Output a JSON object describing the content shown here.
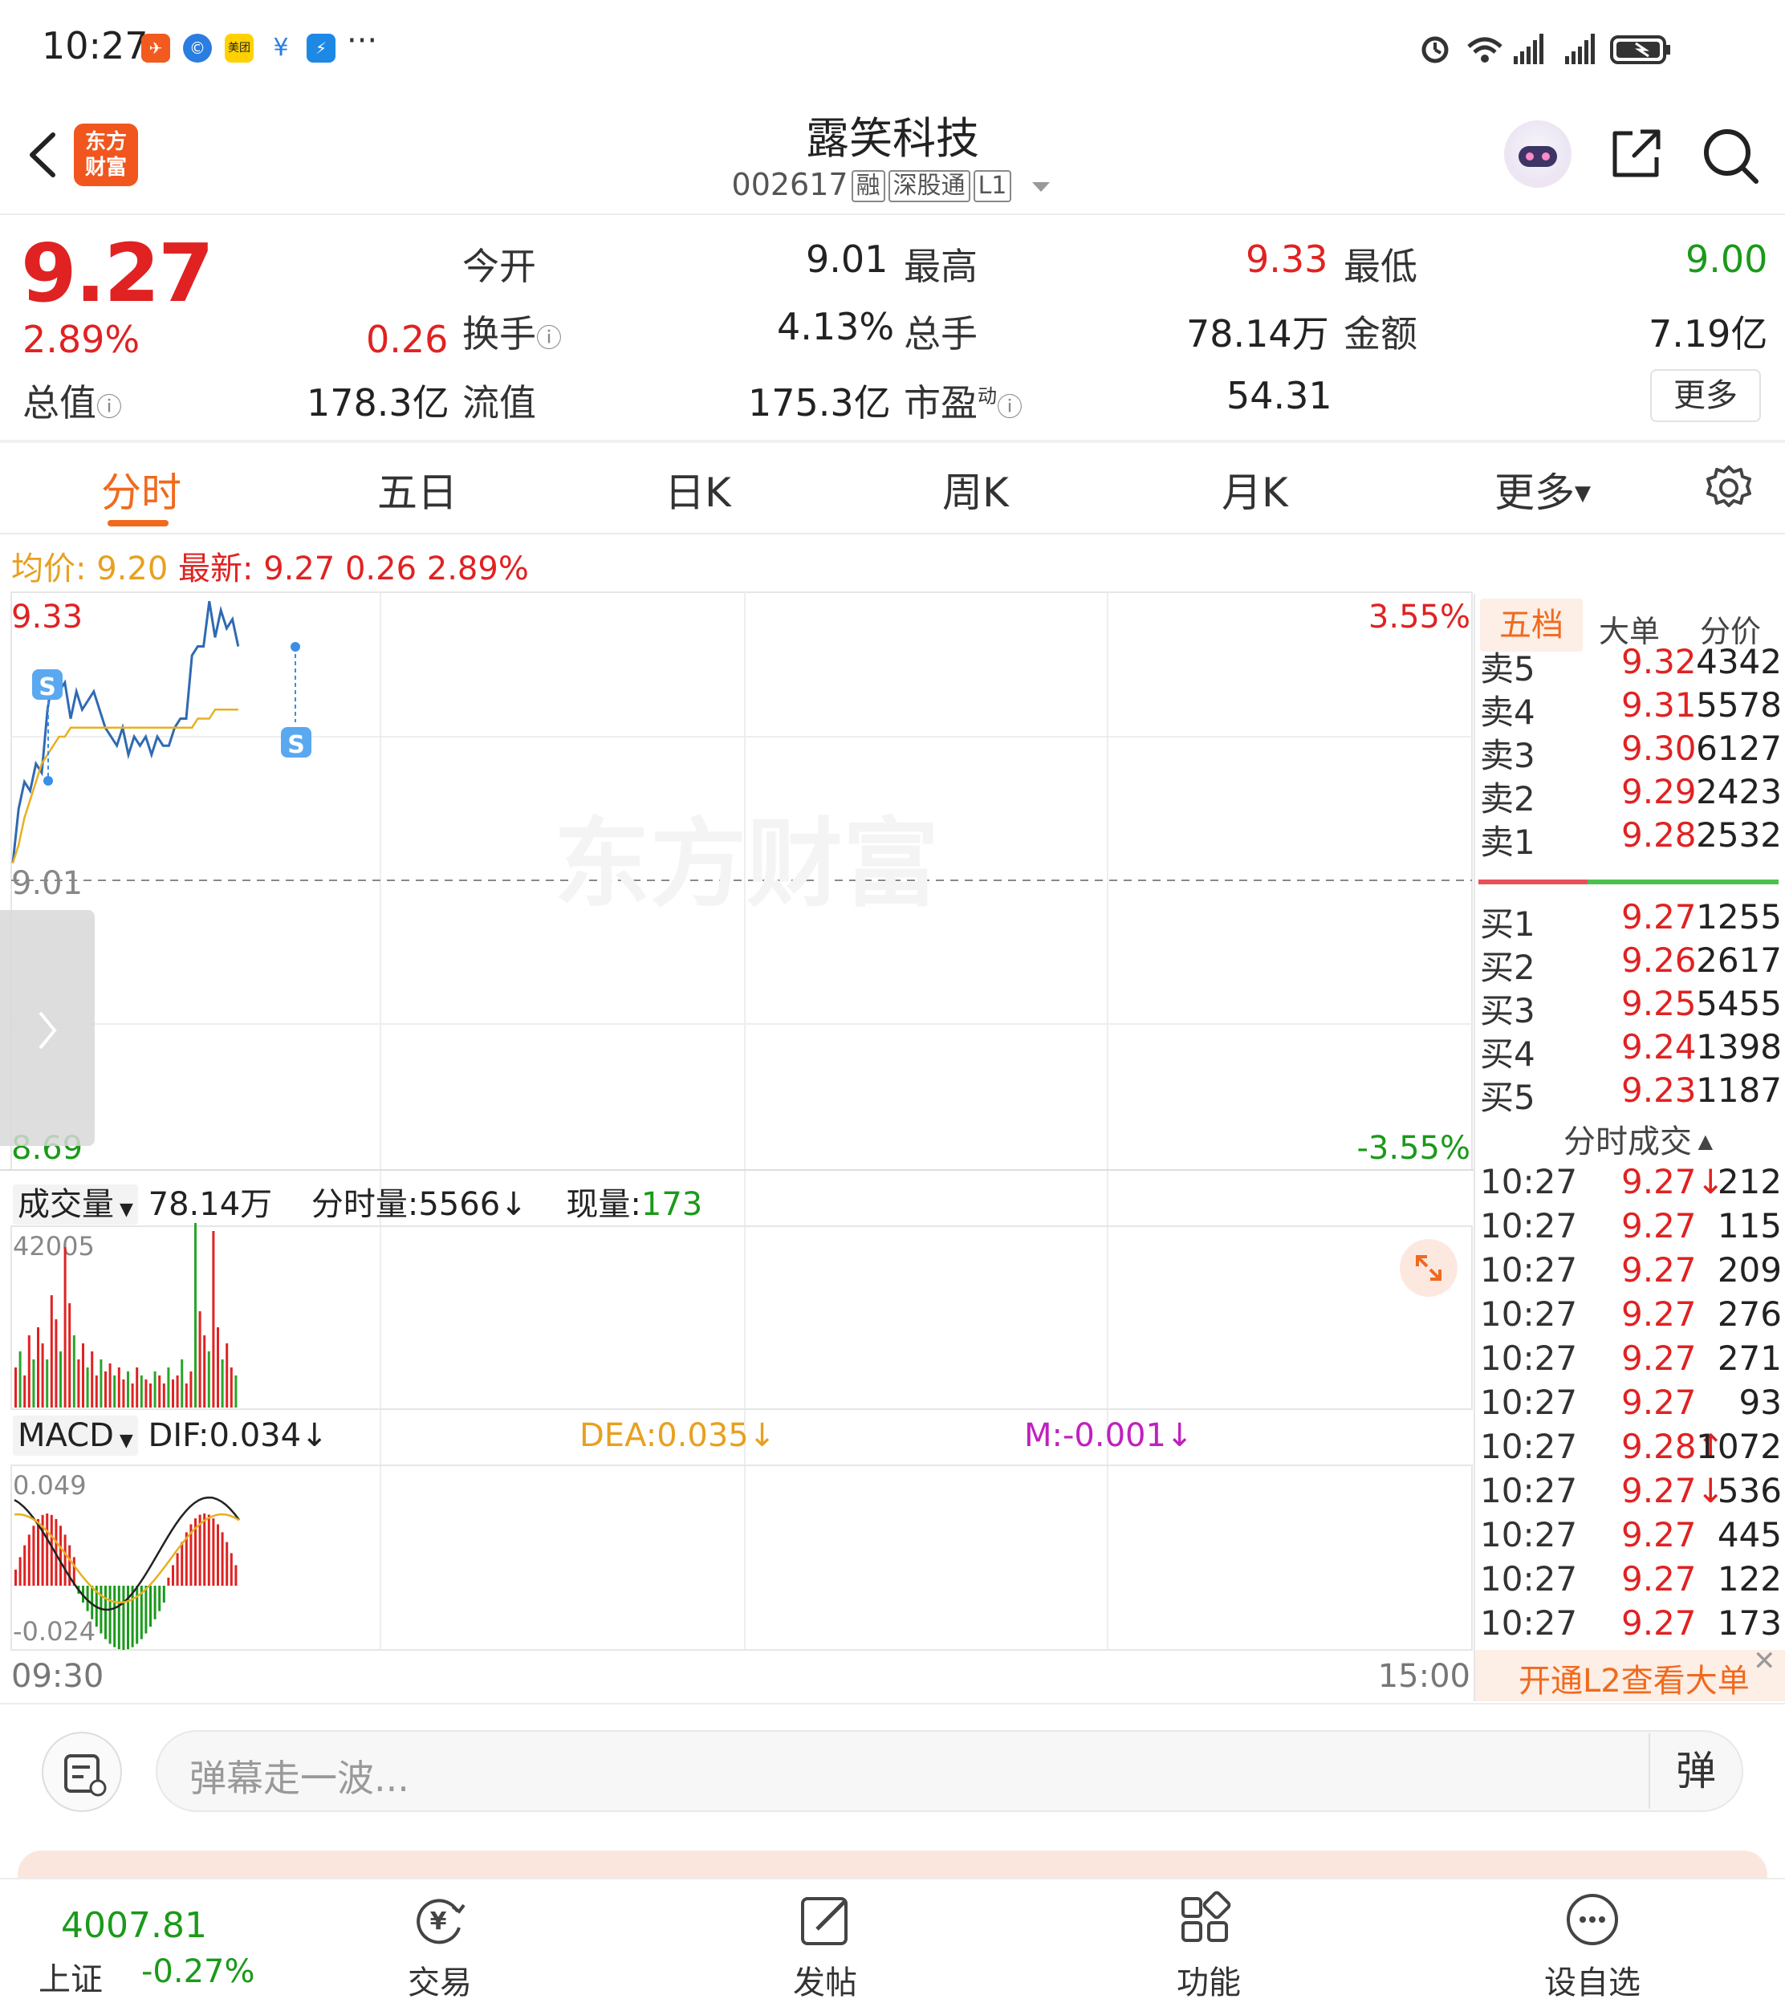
{
  "status_bar": {
    "time": "10:27",
    "more": "···"
  },
  "header": {
    "logo_text_1": "东方",
    "logo_text_2": "财富",
    "stock_name": "露笑科技",
    "stock_code": "002617",
    "tags": [
      "融",
      "深股通",
      "L1"
    ]
  },
  "quote": {
    "price": "9.27",
    "change_pct": "2.89%",
    "change": "0.26",
    "open_label": "今开",
    "open": "9.01",
    "high_label": "最高",
    "high": "9.33",
    "low_label": "最低",
    "low": "9.00",
    "turnover_label": "换手",
    "turnover": "4.13%",
    "volume_label": "总手",
    "volume": "78.14万",
    "amount_label": "金额",
    "amount": "7.19亿",
    "mktcap_label": "总值",
    "mktcap": "178.3亿",
    "float_label": "流值",
    "float_cap": "175.3亿",
    "pe_label": "市盈",
    "pe_sup": "动",
    "pe": "54.31",
    "more_button": "更多"
  },
  "tabs": [
    "分时",
    "五日",
    "日K",
    "周K",
    "月K",
    "更多"
  ],
  "chart_info": {
    "avg_label": "均价:",
    "avg": "9.20",
    "latest_label": "最新:",
    "latest": "9.27",
    "change": "0.26",
    "change_pct": "2.89%",
    "price_top": "9.33",
    "price_base": "9.01",
    "price_bottom": "8.69",
    "pct_top": "3.55%",
    "pct_bottom": "-3.55%",
    "watermark": "东方财富",
    "volume_selector": "成交量",
    "volume_total": "78.14万",
    "tick_volume": "分时量:5566↓",
    "current_volume_label": "现量:",
    "current_volume": "173",
    "volume_max": "42005",
    "macd_selector": "MACD",
    "dif": "DIF:0.034↓",
    "dea": "DEA:0.035↓",
    "m": "M:-0.001↓",
    "macd_max": "0.049",
    "macd_min": "-0.024",
    "time_start": "09:30",
    "time_end": "15:00",
    "signal_marker": "S"
  },
  "chart_data": {
    "type": "line",
    "x_range": [
      "09:30",
      "15:00"
    ],
    "ylim": [
      8.69,
      9.33
    ],
    "reference_price": 9.01,
    "series": [
      {
        "name": "最新",
        "values": [
          9.03,
          9.09,
          9.12,
          9.11,
          9.14,
          9.13,
          9.2,
          9.24,
          9.22,
          9.23,
          9.19,
          9.22,
          9.2,
          9.21,
          9.22,
          9.2,
          9.18,
          9.17,
          9.16,
          9.18,
          9.15,
          9.17,
          9.16,
          9.17,
          9.15,
          9.17,
          9.16,
          9.16,
          9.18,
          9.19,
          9.19,
          9.26,
          9.27,
          9.27,
          9.32,
          9.28,
          9.31,
          9.29,
          9.3,
          9.27
        ]
      },
      {
        "name": "均价",
        "values": [
          9.03,
          9.05,
          9.08,
          9.1,
          9.12,
          9.14,
          9.15,
          9.16,
          9.17,
          9.17,
          9.18,
          9.18,
          9.18,
          9.18,
          9.18,
          9.18,
          9.18,
          9.18,
          9.18,
          9.18,
          9.18,
          9.18,
          9.18,
          9.18,
          9.18,
          9.18,
          9.18,
          9.18,
          9.18,
          9.18,
          9.18,
          9.18,
          9.19,
          9.19,
          9.19,
          9.2,
          9.2,
          9.2,
          9.2,
          9.2
        ]
      }
    ]
  },
  "order_book": {
    "tabs": [
      "五档",
      "大单",
      "分价"
    ],
    "asks": [
      {
        "label": "卖5",
        "price": "9.32",
        "vol": "4342"
      },
      {
        "label": "卖4",
        "price": "9.31",
        "vol": "5578"
      },
      {
        "label": "卖3",
        "price": "9.30",
        "vol": "6127"
      },
      {
        "label": "卖2",
        "price": "9.29",
        "vol": "2423"
      },
      {
        "label": "卖1",
        "price": "9.28",
        "vol": "2532"
      }
    ],
    "bids": [
      {
        "label": "买1",
        "price": "9.27",
        "vol": "1255"
      },
      {
        "label": "买2",
        "price": "9.26",
        "vol": "2617"
      },
      {
        "label": "买3",
        "price": "9.25",
        "vol": "5455"
      },
      {
        "label": "买4",
        "price": "9.24",
        "vol": "1398"
      },
      {
        "label": "买5",
        "price": "9.23",
        "vol": "1187"
      }
    ],
    "trades_title": "分时成交",
    "trades": [
      {
        "time": "10:27",
        "price": "9.27↓",
        "vol": "212"
      },
      {
        "time": "10:27",
        "price": "9.27",
        "vol": "115"
      },
      {
        "time": "10:27",
        "price": "9.27",
        "vol": "209"
      },
      {
        "time": "10:27",
        "price": "9.27",
        "vol": "276"
      },
      {
        "time": "10:27",
        "price": "9.27",
        "vol": "271"
      },
      {
        "time": "10:27",
        "price": "9.27",
        "vol": "93"
      },
      {
        "time": "10:27",
        "price": "9.28↑",
        "vol": "1072"
      },
      {
        "time": "10:27",
        "price": "9.27↓",
        "vol": "536"
      },
      {
        "time": "10:27",
        "price": "9.27",
        "vol": "445"
      },
      {
        "time": "10:27",
        "price": "9.27",
        "vol": "122"
      },
      {
        "time": "10:27",
        "price": "9.27",
        "vol": "173"
      }
    ],
    "l2_promo": "开通L2查看大单"
  },
  "comment": {
    "placeholder": "弹幕走一波...",
    "danmu_button": "弹"
  },
  "bottom_nav": {
    "index_value": "4007.81",
    "index_name": "上证",
    "index_change": "-0.27%",
    "items": [
      "交易",
      "发帖",
      "功能",
      "设自选"
    ]
  },
  "colors": {
    "up": "#e02222",
    "down": "#1a9a1a",
    "accent": "#f06a1e",
    "price_line": "#2f6ab3",
    "avg_line": "#e8b020"
  }
}
